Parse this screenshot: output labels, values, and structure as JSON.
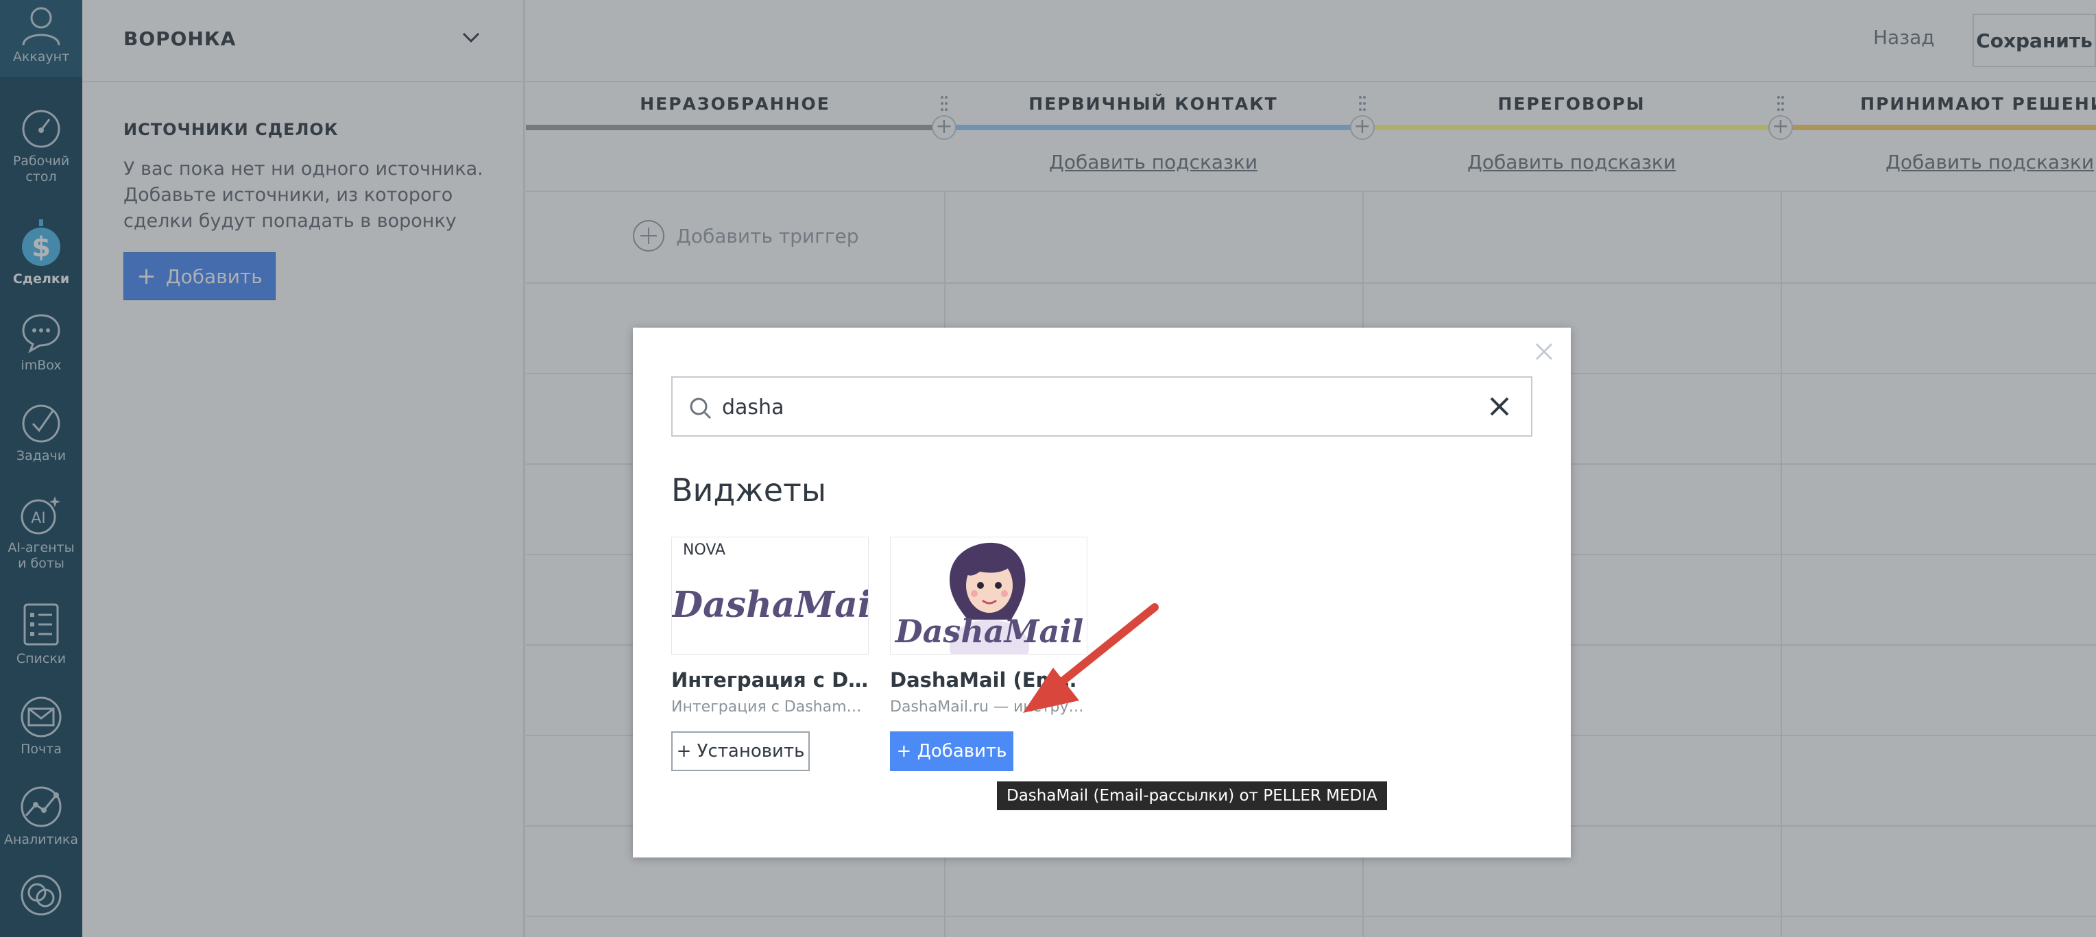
{
  "nav": {
    "items": [
      {
        "label": "Аккаунт",
        "icon": "user-icon"
      },
      {
        "label": "Рабочий стол",
        "icon": "dashboard-icon"
      },
      {
        "label": "Сделки",
        "icon": "deals-icon"
      },
      {
        "label": "imBox",
        "icon": "chat-icon"
      },
      {
        "label": "Задачи",
        "icon": "check-icon"
      },
      {
        "label": "AI-агенты и боты",
        "icon": "ai-icon"
      },
      {
        "label": "Списки",
        "icon": "list-icon"
      },
      {
        "label": "Почта",
        "icon": "mail-icon"
      },
      {
        "label": "Аналитика",
        "icon": "analytics-icon"
      },
      {
        "label": "",
        "icon": "more-icon"
      }
    ],
    "accent": "#16445b"
  },
  "left_panel": {
    "title": "ВОРОНКА",
    "sources_title": "ИСТОЧНИКИ СДЕЛОК",
    "sources_text": "У вас пока нет ни одного источника. Добавьте источники, из которого сделки будут попадать в воронку",
    "add_button": "Добавить"
  },
  "top_bar": {
    "back": "Назад",
    "save": "Сохранить"
  },
  "stages": [
    {
      "name": "НЕРАЗОБРАННОЕ",
      "color": "#9aa0a6",
      "hint": ""
    },
    {
      "name": "ПЕРВИЧНЫЙ КОНТАКТ",
      "color": "#99ccff",
      "hint": "Добавить подсказки"
    },
    {
      "name": "ПЕРЕГОВОРЫ",
      "color": "#fffd7f",
      "hint": "Добавить подсказки"
    },
    {
      "name": "ПРИНИМАЮТ РЕШЕНИЕ",
      "color": "#ffcc66",
      "hint": "Добавить подсказки"
    }
  ],
  "trigger": {
    "label": "Добавить триггер"
  },
  "modal": {
    "search": {
      "value": "dasha",
      "placeholder": ""
    },
    "section_title": "Виджеты",
    "widgets": [
      {
        "badge": "NOVA",
        "logo_text": "DashaMail",
        "title": "Интеграция с Dasha...",
        "description": "Интеграция с Dashamail ...",
        "button": "+ Установить"
      },
      {
        "badge": "",
        "logo_text": "DashaMail",
        "title": "DashaMail (Email-...",
        "description": "DashaMail.ru — инструме...",
        "button": "+ Добавить"
      }
    ],
    "tooltip": "DashaMail (Email-рассылки) от PELLER MEDIA"
  },
  "colors": {
    "primary_button": "#4c8bf5",
    "annotation_arrow": "#d9463b"
  }
}
